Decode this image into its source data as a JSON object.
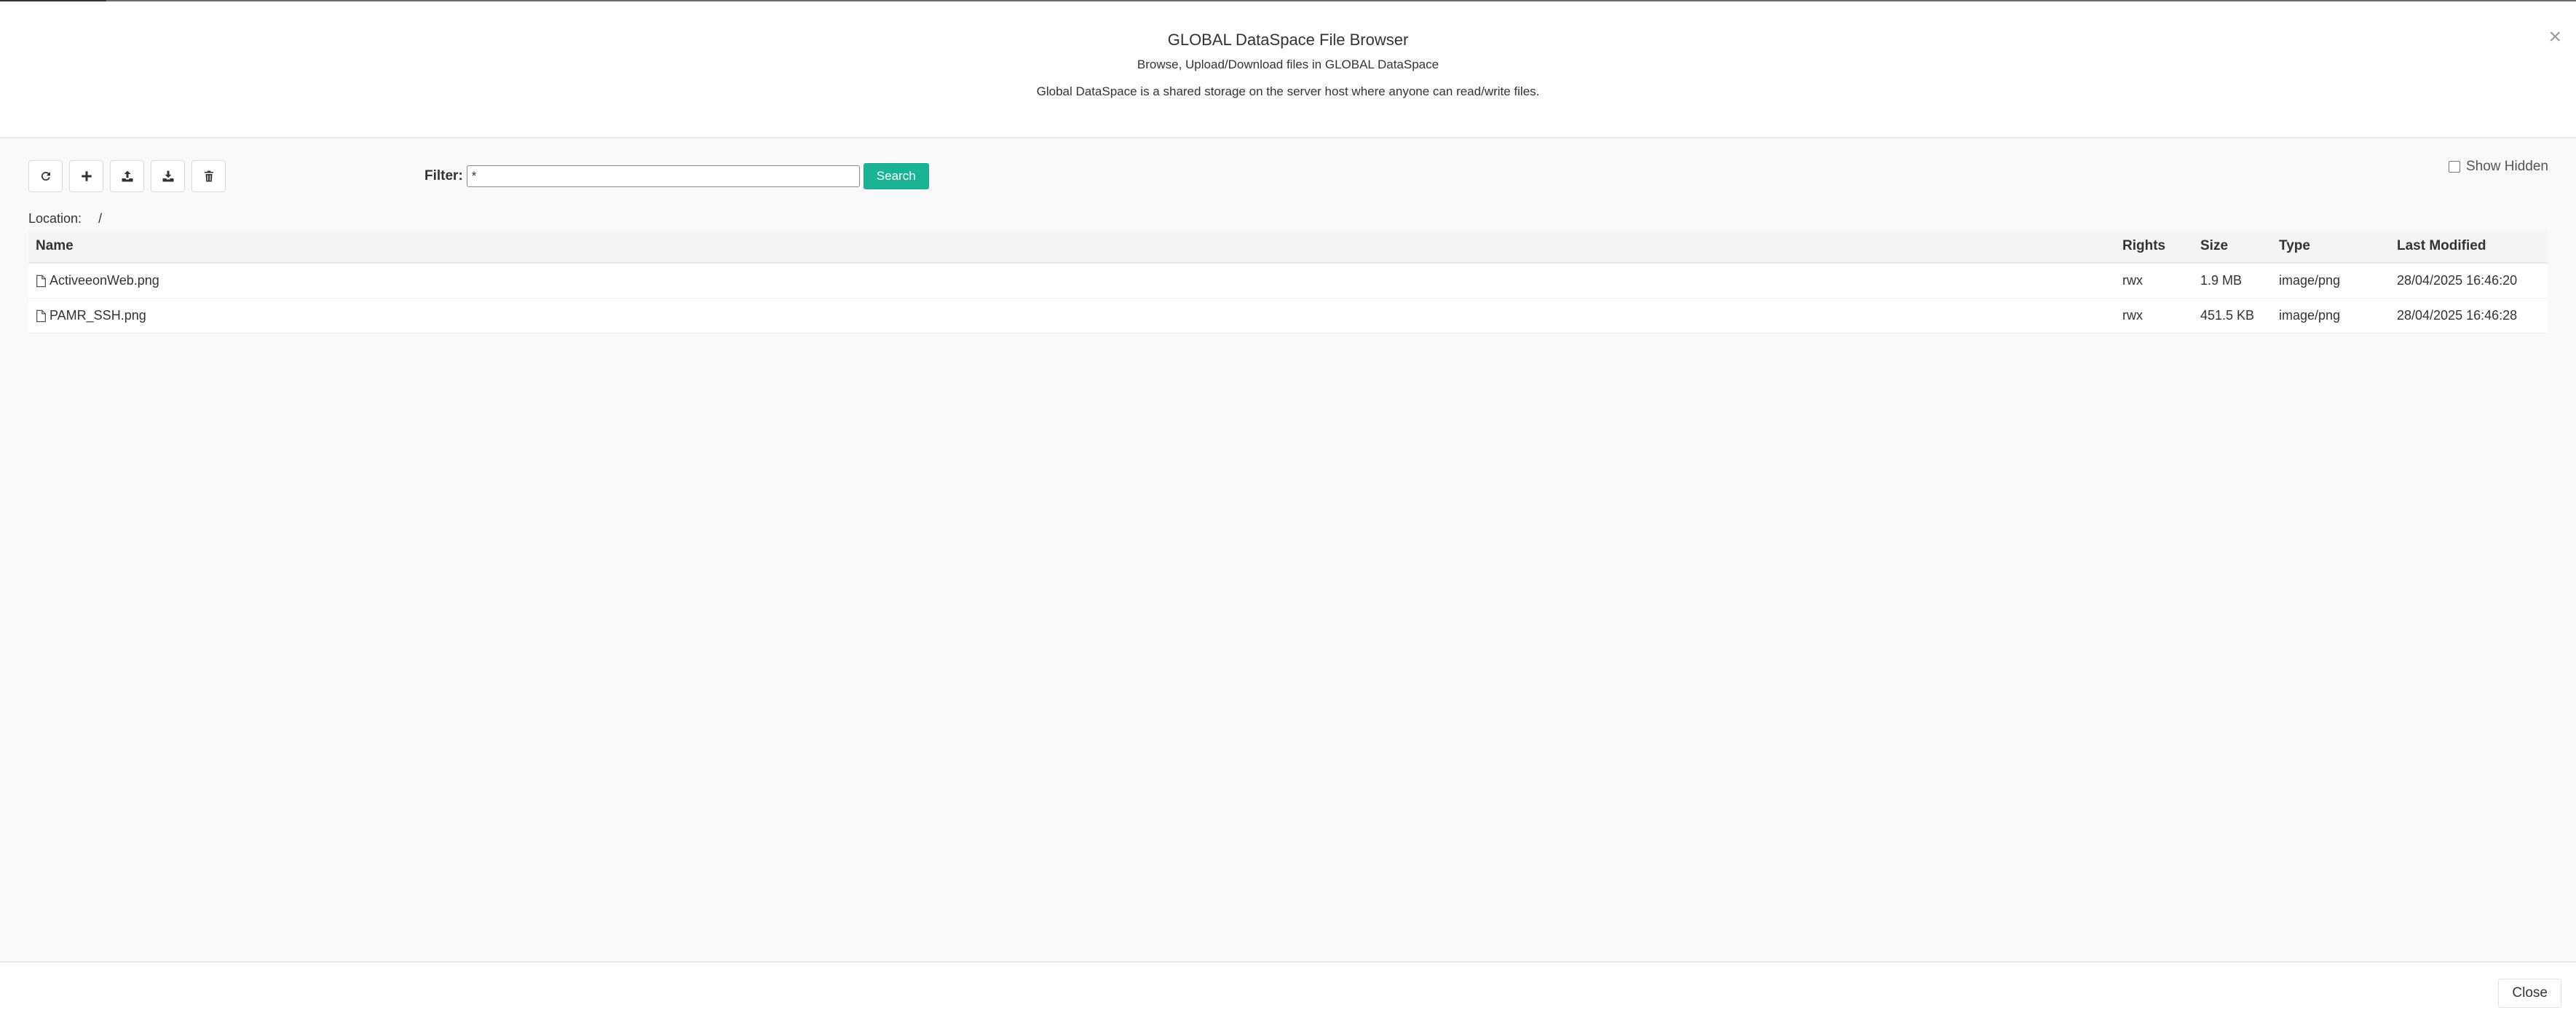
{
  "dialog": {
    "title": "GLOBAL DataSpace File Browser",
    "subtitle": "Browse, Upload/Download files in GLOBAL DataSpace",
    "description": "Global DataSpace is a shared storage on the server host where anyone can read/write files.",
    "close_x": "×"
  },
  "toolbar": {
    "buttons": [
      {
        "name": "refresh",
        "icon": "refresh-icon"
      },
      {
        "name": "new-folder",
        "icon": "plus-icon"
      },
      {
        "name": "upload",
        "icon": "upload-icon"
      },
      {
        "name": "download",
        "icon": "download-icon"
      },
      {
        "name": "delete",
        "icon": "trash-icon"
      }
    ]
  },
  "filter": {
    "label": "Filter:",
    "value": "*",
    "search_label": "Search"
  },
  "show_hidden": {
    "label": "Show Hidden",
    "checked": false
  },
  "location": {
    "label": "Location:",
    "path": "/"
  },
  "table": {
    "columns": [
      "Name",
      "Rights",
      "Size",
      "Type",
      "Last Modified"
    ],
    "rows": [
      {
        "name": "ActiveeonWeb.png",
        "rights": "rwx",
        "size": "1.9 MB",
        "type": "image/png",
        "modified": "28/04/2025 16:46:20"
      },
      {
        "name": "PAMR_SSH.png",
        "rights": "rwx",
        "size": "451.5 KB",
        "type": "image/png",
        "modified": "28/04/2025 16:46:28"
      }
    ]
  },
  "footer": {
    "close_label": "Close"
  },
  "colors": {
    "accent": "#1ab394"
  }
}
